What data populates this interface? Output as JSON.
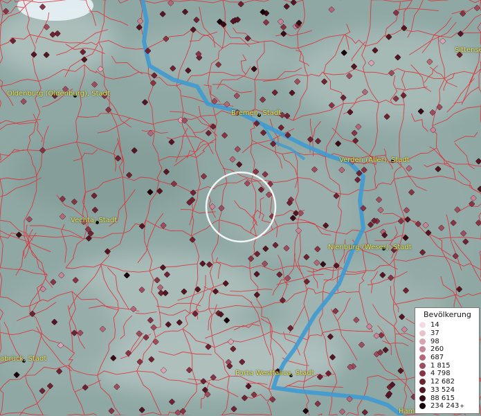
{
  "map": {
    "cities": [
      {
        "name": "Oldenburg (Oldenburg), Stadt"
      },
      {
        "name": "Bremen, Stadt"
      },
      {
        "name": "Verden (Aller), Stadt"
      },
      {
        "name": "Vechta, Stadt"
      },
      {
        "name": "Nienburg (Weser), Stadt"
      },
      {
        "name": "Porta Westfalica, Stadt"
      },
      {
        "name": "abrück, Stadt"
      },
      {
        "name": "Sittense"
      },
      {
        "name": "Ham"
      }
    ],
    "colors": {
      "terrain": "#8fa8a4",
      "boundaries": "#e0282f",
      "river": "#3f9ad2",
      "label": "#f3e34a"
    }
  },
  "legend": {
    "title": "Bevölkerung",
    "items": [
      {
        "label": "14",
        "color": "#f3dde4"
      },
      {
        "label": "37",
        "color": "#e8c2cd"
      },
      {
        "label": "98",
        "color": "#d9a3b1"
      },
      {
        "label": "260",
        "color": "#c78595"
      },
      {
        "label": "687",
        "color": "#b36878"
      },
      {
        "label": "1 815",
        "color": "#9e4d5d"
      },
      {
        "label": "4 798",
        "color": "#873545"
      },
      {
        "label": "12 682",
        "color": "#6d2331"
      },
      {
        "label": "33 524",
        "color": "#531622"
      },
      {
        "label": "88 615",
        "color": "#380c15"
      },
      {
        "label": "234 243",
        "color": "#16040a",
        "plus": "+"
      }
    ]
  }
}
